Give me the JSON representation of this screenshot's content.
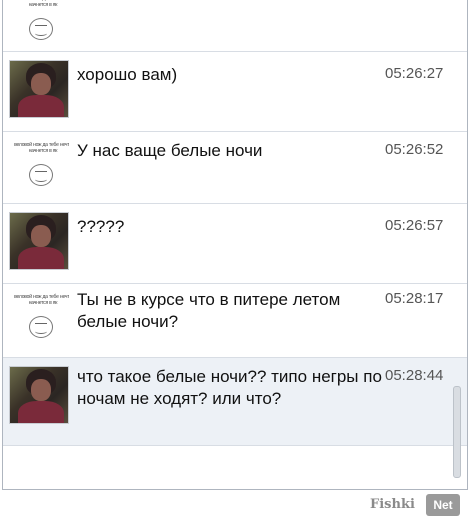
{
  "meme_caption": "веловой нож да тебе нечто начнется в як",
  "messages": [
    {
      "author": "meme",
      "text": "",
      "time": ""
    },
    {
      "author": "photo",
      "text": "хорошо вам)",
      "time": "05:26:27"
    },
    {
      "author": "meme",
      "text": "У нас ваще белые ночи",
      "time": "05:26:52"
    },
    {
      "author": "photo",
      "text": "?????",
      "time": "05:26:57"
    },
    {
      "author": "meme",
      "text": "Ты не в курсе что в питере летом белые ночи?",
      "time": "05:28:17"
    },
    {
      "author": "photo",
      "text": "что такое белые ночи?? типо негры по ночам не ходят? или что?",
      "time": "05:28:44"
    }
  ],
  "watermark": {
    "text": "Fishki",
    "badge": "Net"
  }
}
